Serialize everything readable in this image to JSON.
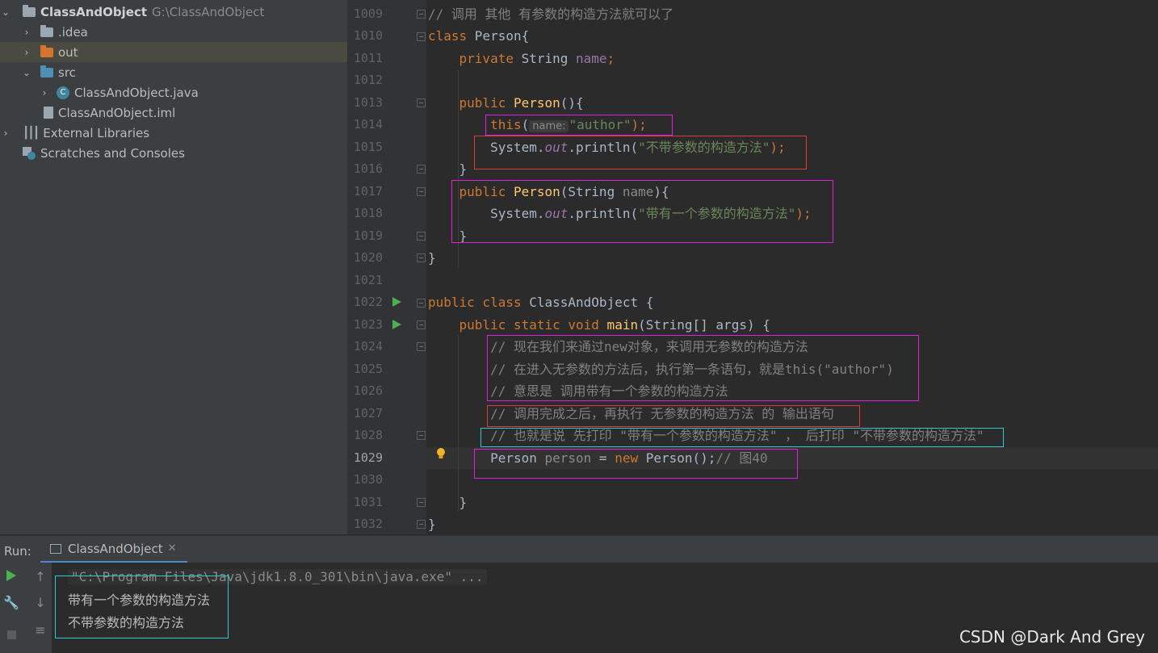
{
  "project": {
    "root_name": "ClassAndObject",
    "root_path": "G:\\ClassAndObject",
    "items": [
      {
        "label": ".idea"
      },
      {
        "label": "out"
      },
      {
        "label": "src"
      },
      {
        "label": "ClassAndObject.java"
      },
      {
        "label": "ClassAndObject.iml"
      },
      {
        "label": "External Libraries"
      },
      {
        "label": "Scratches and Consoles"
      }
    ]
  },
  "editor": {
    "line_numbers": [
      "1009",
      "1010",
      "1011",
      "1012",
      "1013",
      "1014",
      "1015",
      "1016",
      "1017",
      "1018",
      "1019",
      "1020",
      "1021",
      "1022",
      "1023",
      "1024",
      "1025",
      "1026",
      "1027",
      "1028",
      "1029",
      "1030",
      "1031",
      "1032"
    ],
    "current_line": "1029",
    "lines": {
      "l1009": "// 调用 其他 有参数的构造方法就可以了",
      "l1010_kw": "class",
      "l1010_rest": " Person{",
      "l1011_kw": "private",
      "l1011_type": " String ",
      "l1011_name": "name",
      "l1011_semi": ";",
      "l1013_kw": "public",
      "l1013_fn": " Person",
      "l1013_rest": "(){",
      "l1014_kw": "this",
      "l1014_open": "(",
      "l1014_hint": "name:",
      "l1014_str": "\"author\"",
      "l1014_close": ");",
      "l1015_a": "System.",
      "l1015_fld": "out",
      "l1015_b": ".println(",
      "l1015_str": "\"不带参数的构造方法\"",
      "l1015_c": ");",
      "l1016": "}",
      "l1017_kw": "public",
      "l1017_fn": " Person",
      "l1017_a": "(String ",
      "l1017_par": "name",
      "l1017_b": "){",
      "l1018_a": "System.",
      "l1018_fld": "out",
      "l1018_b": ".println(",
      "l1018_str": "\"带有一个参数的构造方法\"",
      "l1018_c": ");",
      "l1019": "}",
      "l1020": "}",
      "l1022_kw": "public class",
      "l1022_rest": " ClassAndObject {",
      "l1023_kw": "public static void",
      "l1023_fn": " main",
      "l1023_rest": "(String[] args) {",
      "l1024": "// 现在我们来通过new对象，来调用无参数的构造方法",
      "l1025": "// 在进入无参数的方法后，执行第一条语句，就是this(\"author\")",
      "l1026": "// 意思是 调用带有一个参数的构造方法",
      "l1027": "// 调用完成之后，再执行 无参数的构造方法 的 输出语句",
      "l1028": "// 也就是说 先打印 \"带有一个参数的构造方法\" ， 后打印 \"不带参数的构造方法\"",
      "l1029_a": "Person ",
      "l1029_var": "person",
      "l1029_b": " = ",
      "l1029_kw": "new",
      "l1029_c": " Person();",
      "l1029_cm": "// 图40",
      "l1031": "}",
      "l1032": "}"
    }
  },
  "run": {
    "label": "Run:",
    "tab_label": "ClassAndObject",
    "command": "\"C:\\Program Files\\Java\\jdk1.8.0_301\\bin\\java.exe\" ...",
    "output": [
      "带有一个参数的构造方法",
      "不带参数的构造方法"
    ]
  },
  "watermark": "CSDN @Dark And Grey",
  "colors": {
    "highlight_magenta": "#e020e0",
    "highlight_red": "#e03a3a",
    "highlight_cyan": "#2ec7d8",
    "run_green": "#4caf50"
  }
}
